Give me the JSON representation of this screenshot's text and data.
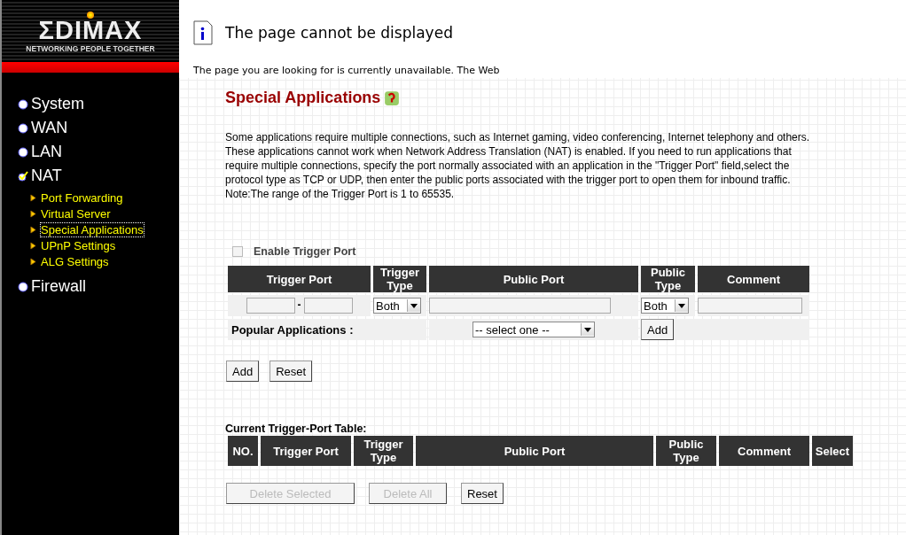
{
  "logo": {
    "brand": "ΣDIMAX",
    "tagline": "NETWORKING PEOPLE TOGETHER"
  },
  "error_frame": {
    "title": "The page cannot be displayed",
    "message": "The page you are looking for is currently unavailable. The Web"
  },
  "sidebar": {
    "items": [
      {
        "label": "System",
        "selected": false
      },
      {
        "label": "WAN",
        "selected": false
      },
      {
        "label": "LAN",
        "selected": false
      },
      {
        "label": "NAT",
        "selected": true,
        "children": [
          {
            "label": "Port Forwarding",
            "selected": false
          },
          {
            "label": "Virtual Server",
            "selected": false
          },
          {
            "label": "Special Applications",
            "selected": true
          },
          {
            "label": "UPnP Settings",
            "selected": false
          },
          {
            "label": "ALG Settings",
            "selected": false
          }
        ]
      },
      {
        "label": "Firewall",
        "selected": false
      }
    ]
  },
  "page_title": "Special Applications",
  "description": "Some applications require multiple connections, such as Internet gaming, video conferencing, Internet telephony and others. These applications cannot work when Network Address Translation (NAT) is enabled. If you need to run applications that require multiple connections, specify the port normally associated with an application in the \"Trigger Port\" field,select the protocol type as TCP or UDP, then enter the public ports associated with the trigger port to open them for inbound traffic.",
  "note": "Note:The range of the Trigger Port is 1 to 65535.",
  "enable_trigger_port": {
    "label": "Enable Trigger Port",
    "checked": false,
    "disabled": true
  },
  "form_table": {
    "columns": [
      "Trigger Port",
      "Trigger Type",
      "Public Port",
      "Public Type",
      "Comment"
    ],
    "range_separator": "-",
    "trigger_type": "Both",
    "public_type": "Both",
    "popular_label": "Popular Applications :",
    "popular_select": "-- select one --",
    "popular_add": "Add"
  },
  "form_buttons": [
    "Add",
    "Reset"
  ],
  "current_table": {
    "title": "Current Trigger-Port Table:",
    "columns": [
      "NO.",
      "Trigger Port",
      "Trigger Type",
      "Public Port",
      "Public Type",
      "Comment",
      "Select"
    ]
  },
  "table_buttons": [
    {
      "label": "Delete Selected",
      "disabled": true
    },
    {
      "label": "Delete All",
      "disabled": true
    },
    {
      "label": "Reset",
      "disabled": false
    }
  ]
}
